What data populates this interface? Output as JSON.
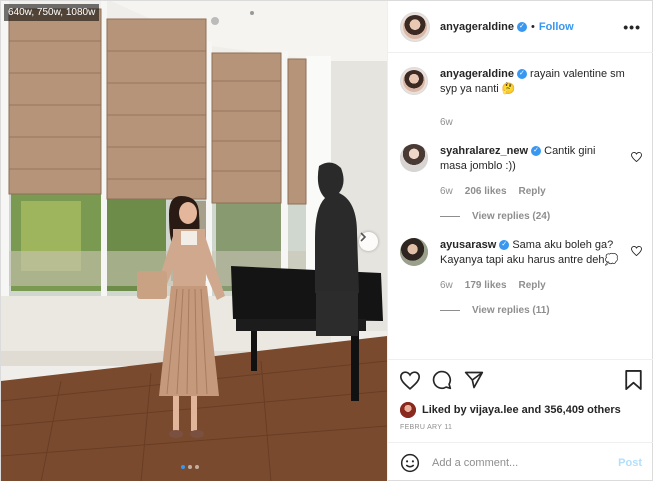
{
  "photo": {
    "resolution_label": "640w, 750w, 1080w",
    "carousel_count": 3,
    "carousel_active": 1
  },
  "header": {
    "username": "anyageraldine",
    "verified": true,
    "separator": "•",
    "follow_label": "Follow",
    "more_label": "•••"
  },
  "caption": {
    "username": "anyageraldine",
    "text": "rayain valentine sm syp ya nanti 🤔",
    "age": "6w"
  },
  "comments": [
    {
      "username": "syahralarez_new",
      "verified": true,
      "text": "Cantik gini masa jomblo :))",
      "age": "6w",
      "likes": "206 likes",
      "reply_label": "Reply",
      "view_replies": "View replies (24)"
    },
    {
      "username": "ayusarasw",
      "verified": true,
      "text": "Sama aku boleh ga? Kayanya tapi aku harus antre deh💭",
      "age": "6w",
      "likes": "179 likes",
      "reply_label": "Reply",
      "view_replies": "View replies (11)"
    }
  ],
  "actions": {
    "icons": [
      "heart-icon",
      "comment-icon",
      "share-icon",
      "bookmark-icon"
    ]
  },
  "likes": {
    "prefix": "Liked by ",
    "user": "vijaya.lee",
    "middle": " and ",
    "others": "356,409 others"
  },
  "date": "FEBRU ARY 11",
  "add_comment": {
    "placeholder": "Add a comment...",
    "post_label": "Post"
  },
  "colors": {
    "accent": "#3897f0",
    "post_disabled": "#b2dffc",
    "muted": "#8e8e8e"
  }
}
